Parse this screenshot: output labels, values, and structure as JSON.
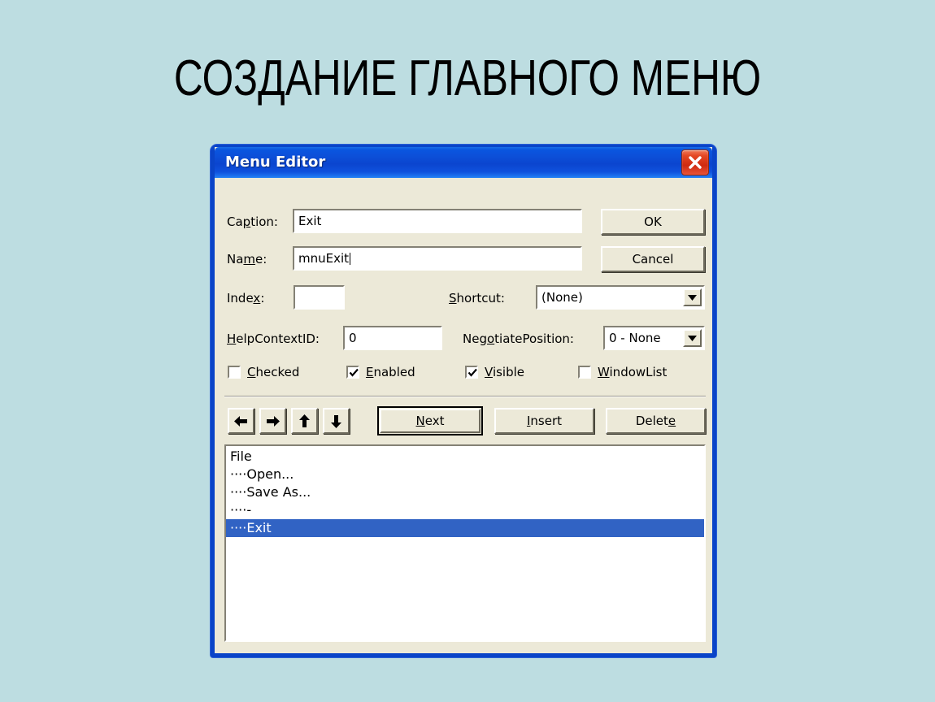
{
  "slide": {
    "title": "СОЗДАНИЕ ГЛАВНОГО МЕНЮ",
    "background_color": "#bddde1"
  },
  "dialog": {
    "title": "Menu Editor",
    "titlebar_color": "#0b4ad4",
    "face_color": "#ece9d8",
    "frame_color": "#0a44c8",
    "close_button": {
      "icon": "close-icon",
      "color": "#d9361a"
    },
    "fields": {
      "caption": {
        "label": "Caption:",
        "label_pre": "Ca",
        "label_accel": "p",
        "label_post": "tion:",
        "value": "Exit",
        "placeholder": ""
      },
      "name": {
        "label": "Name:",
        "label_pre": "Na",
        "label_accel": "m",
        "label_post": "e:",
        "value": "mnuExit",
        "placeholder": ""
      },
      "index": {
        "label": "Index:",
        "label_pre": "Inde",
        "label_accel": "x",
        "label_post": ":",
        "value": "",
        "placeholder": ""
      },
      "help_context_id": {
        "label": "HelpContextID:",
        "label_pre": "",
        "label_accel": "H",
        "label_post": "elpContextID:",
        "value": "0",
        "placeholder": ""
      },
      "shortcut": {
        "label": "Shortcut:",
        "label_pre": "",
        "label_accel": "S",
        "label_post": "hortcut:",
        "value": "(None)",
        "options": [
          "(None)"
        ]
      },
      "negotiate_position": {
        "label": "NegotiatePosition:",
        "label_pre": "Neg",
        "label_accel": "o",
        "label_post": "tiatePosition:",
        "value": "0 - None",
        "options": [
          "0 - None"
        ]
      }
    },
    "checkboxes": [
      {
        "name": "checked",
        "label_pre": "",
        "label_accel": "C",
        "label_post": "hecked",
        "label": "Checked",
        "checked": false
      },
      {
        "name": "enabled",
        "label_pre": "",
        "label_accel": "E",
        "label_post": "nabled",
        "label": "Enabled",
        "checked": true
      },
      {
        "name": "visible",
        "label_pre": "",
        "label_accel": "V",
        "label_post": "isible",
        "label": "Visible",
        "checked": true
      },
      {
        "name": "windowlist",
        "label_pre": "",
        "label_accel": "W",
        "label_post": "indowList",
        "label": "WindowList",
        "checked": false
      }
    ],
    "arrow_buttons": [
      {
        "name": "move-left-button",
        "icon": "arrow-left-icon"
      },
      {
        "name": "move-right-button",
        "icon": "arrow-right-icon"
      },
      {
        "name": "move-up-button",
        "icon": "arrow-up-icon"
      },
      {
        "name": "move-down-button",
        "icon": "arrow-down-icon"
      }
    ],
    "buttons": {
      "ok": "OK",
      "cancel": "Cancel",
      "next": "Next",
      "next_pre": "",
      "next_accel": "N",
      "next_post": "ext",
      "insert": "Insert",
      "insert_pre": "",
      "insert_accel": "I",
      "insert_post": "nsert",
      "delete": "Delete",
      "delete_pre": "Delet",
      "delete_accel": "e",
      "delete_post": ""
    },
    "menu_list": {
      "selection_color": "#3163c4",
      "items": [
        {
          "text": "File",
          "selected": false
        },
        {
          "text": "····Open...",
          "selected": false
        },
        {
          "text": "····Save As...",
          "selected": false
        },
        {
          "text": "····-",
          "selected": false
        },
        {
          "text": "····Exit",
          "selected": true
        }
      ]
    }
  }
}
